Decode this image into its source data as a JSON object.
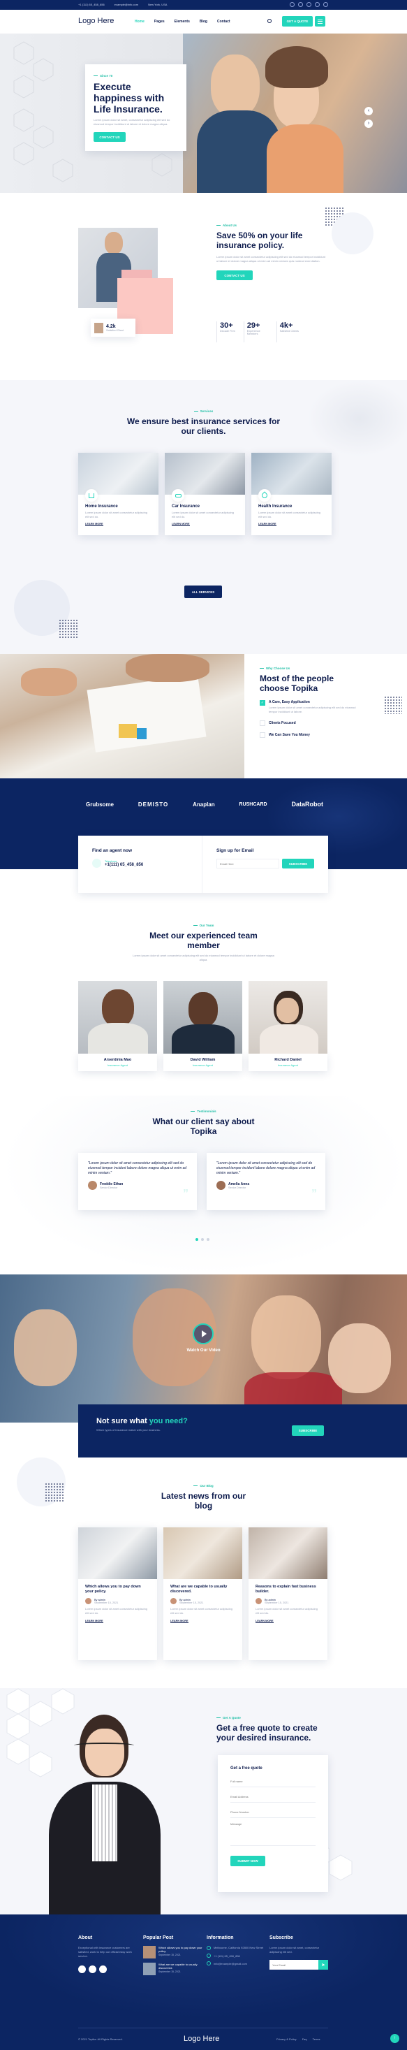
{
  "topbar": {
    "phone": "+1 (111) 65_458_856",
    "email": "example@info.com",
    "address": "New York, USA"
  },
  "header": {
    "logo": "Logo Here",
    "nav": [
      "Home",
      "Pages",
      "Elements",
      "Blog",
      "Contact"
    ],
    "cta": "GET A QUOTE"
  },
  "hero": {
    "subtitle": "Since 70",
    "title": "Execute happiness with Life Insurance.",
    "text": "Lorem ipsum dolor sit amet, consectetur adipiscing elit sed do eiusmod tempor incididunt ut labore et dolore magna aliqua.",
    "button": "CONTACT US"
  },
  "about": {
    "subtitle": "About Us",
    "title": "Save 50% on your life insurance policy.",
    "text": "Lorem ipsum dolor sit amet consectetur adipiscing elit sed do eiusmod tempor incididunt ut labore et dolore magna aliqua ut enim ad minim veniam quis nostrud exercitation.",
    "button": "CONTACT US",
    "badge_value": "4.2k",
    "badge_label": "Satisfied Client",
    "stats": [
      {
        "value": "30+",
        "label": "Decade Firm"
      },
      {
        "value": "29+",
        "label": "Experience Members"
      },
      {
        "value": "4k+",
        "label": "Satisfied Clients"
      }
    ]
  },
  "services": {
    "subtitle": "Services",
    "title": "We ensure best insurance services for our clients.",
    "button": "ALL SERVICES",
    "items": [
      {
        "title": "Home Insurance",
        "text": "Lorem ipsum dolor sit amet consectetur adipiscing elit sed do.",
        "more": "LEARN MORE"
      },
      {
        "title": "Car Insurance",
        "text": "Lorem ipsum dolor sit amet consectetur adipiscing elit sed do.",
        "more": "LEARN MORE"
      },
      {
        "title": "Health Insurance",
        "text": "Lorem ipsum dolor sit amet consectetur adipiscing elit sed do.",
        "more": "LEARN MORE"
      }
    ]
  },
  "why": {
    "subtitle": "Why Choose Us",
    "title": "Most of the people choose Topika",
    "items": [
      {
        "title": "A Care, Easy Application",
        "text": "Lorem ipsum dolor sit amet consectetur adipiscing elit sed do eiusmod tempor incididunt ut labore."
      },
      {
        "title": "Clients Focused"
      },
      {
        "title": "We Can Save You Money"
      }
    ]
  },
  "partners": [
    "Grubsome",
    "DEMISTO",
    "Anaplan",
    "RUSHCARD",
    "DataRobot"
  ],
  "contact": {
    "agent_title": "Find an agent now",
    "phone_label": "Telephone",
    "phone": "+1(111) 65_458_856",
    "email_title": "Sign up for Email",
    "email_placeholder": "Email Here",
    "subscribe": "SUBSCRIBE"
  },
  "team": {
    "subtitle": "Our Team",
    "title": "Meet our experienced team member",
    "text": "Lorem ipsum dolor sit amet consectetur adipiscing elit sed do eiusmod tempor incididunt ut labore et dolore magna aliqua.",
    "members": [
      {
        "name": "Arsentinia Mao",
        "role": "Insurance Agent"
      },
      {
        "name": "David William",
        "role": "Insurance Agent"
      },
      {
        "name": "Richard Daniel",
        "role": "Insurance Agent"
      }
    ]
  },
  "testimonials": {
    "subtitle": "Testimonials",
    "title": "What our client say about Topika",
    "items": [
      {
        "text": "\"Lorem ipsum dolor sit amet consectetur adipiscing elit sed do eiusmod tempor incidunt labore dolore magna aliqua ut enim ad minim veniam.\"",
        "name": "Freddie Ethan",
        "role": "Senior Director"
      },
      {
        "text": "\"Lorem ipsum dolor sit amet consectetur adipiscing elit sed do eiusmod tempor incidunt labore dolore magna aliqua ut enim ad minim veniam.\"",
        "name": "Amelia Anna",
        "role": "Senior Director"
      }
    ]
  },
  "video": {
    "label": "Watch Our Video"
  },
  "banner": {
    "title_a": "Not sure what ",
    "title_b": "you need?",
    "text": "Which types of insurance match with your business.",
    "button": "SUBSCRIBE"
  },
  "news": {
    "subtitle": "Our Blog",
    "title": "Latest news from our blog",
    "items": [
      {
        "title": "Which allows you to pay down your policy.",
        "author": "By admin",
        "date": "September 15, 2021",
        "text": "Lorem ipsum dolor sit amet consectetur adipiscing elit sed do.",
        "more": "LEARN MORE"
      },
      {
        "title": "What are we capable to usually discovered.",
        "author": "By admin",
        "date": "September 15, 2021",
        "text": "Lorem ipsum dolor sit amet consectetur adipiscing elit sed do.",
        "more": "LEARN MORE"
      },
      {
        "title": "Reasons to explain fast business builder.",
        "author": "By admin",
        "date": "September 15, 2021",
        "text": "Lorem ipsum dolor sit amet consectetur adipiscing elit sed do.",
        "more": "LEARN MORE"
      }
    ]
  },
  "quote": {
    "subtitle": "Get A Quote",
    "title": "Get a free quote to create your desired insurance.",
    "form_title": "Get a free quote",
    "fields": [
      "Full name",
      "Email Address",
      "Phone Number",
      "Message"
    ],
    "button": "SUBMIT NOW"
  },
  "footer": {
    "about_title": "About",
    "about_text": "Exceptional with insurance customers are satisfied, work to help our official easy work service.",
    "popular_title": "Popular Post",
    "posts": [
      {
        "title": "Which allows you to pay down your policy.",
        "date": "September 15, 2021"
      },
      {
        "title": "What are we capable to usually discovered.",
        "date": "September 15, 2021"
      }
    ],
    "info_title": "Information",
    "info": [
      "Melbourne, California 92800 New Street",
      "+1 (111) 65_458_856",
      "info@example@gmail.com"
    ],
    "subscribe_title": "Subscribe",
    "subscribe_text": "Lorem ipsum dolor sit amet, consectetur adipiscing elit sed.",
    "email_placeholder": "Your Email",
    "copyright": "© 2021 Topika. All Rights Reserved.",
    "logo": "Logo Here",
    "links": [
      "Privacy & Policy",
      "Faq",
      "Terms"
    ]
  },
  "colors": {
    "navy": "#0c2562",
    "teal": "#22d5bb"
  }
}
